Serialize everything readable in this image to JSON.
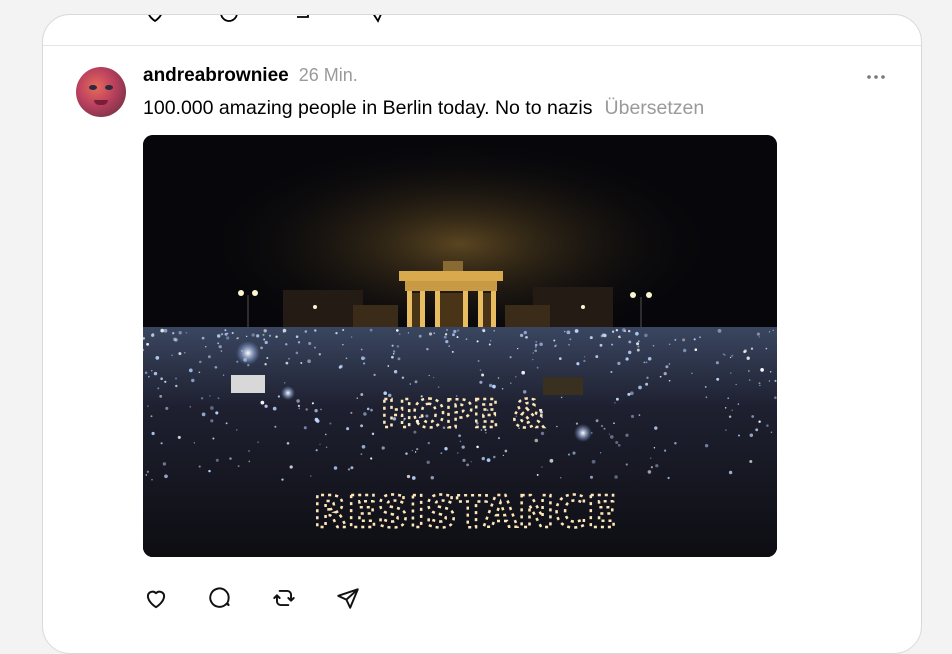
{
  "post": {
    "username": "andreabrowniee",
    "time": "26 Min.",
    "text": "100.000 amazing people in Berlin today. No to nazis",
    "translate_label": "Übersetzen"
  },
  "photo": {
    "sign_line1": "HOPE &",
    "sign_line2": "RESISTANCE"
  },
  "icons": {
    "like": "heart-icon",
    "reply": "comment-icon",
    "repost": "repost-icon",
    "share": "send-icon",
    "more": "more-icon"
  },
  "colors": {
    "muted": "#9a9a9a",
    "gate_light": "#f3c96b",
    "crowd_light": "#bcd6ff"
  }
}
